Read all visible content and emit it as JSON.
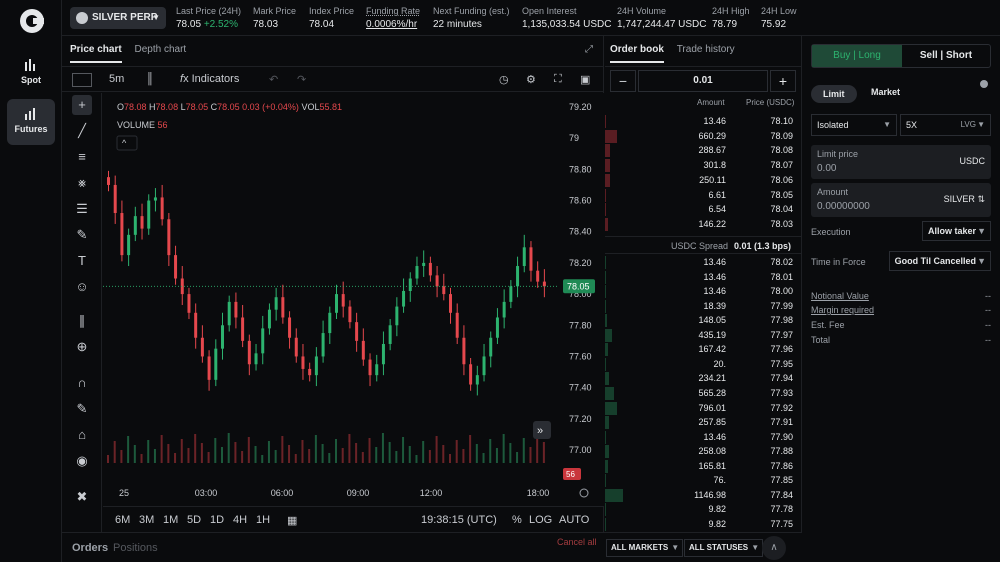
{
  "nav": {
    "items": [
      {
        "label": "Spot",
        "active": false
      },
      {
        "label": "Futures",
        "active": true
      }
    ]
  },
  "header": {
    "market": "SILVER PERP",
    "stats": [
      {
        "label": "Last Price (24H)",
        "value": "78.05",
        "change": "+2.52%"
      },
      {
        "label": "Mark Price",
        "value": "78.03"
      },
      {
        "label": "Index Price",
        "value": "78.04"
      },
      {
        "label": "Funding Rate",
        "value": "0.0006%/hr"
      },
      {
        "label": "Next Funding (est.)",
        "value": "22 minutes"
      },
      {
        "label": "Open Interest",
        "value": "1,135,033.54 USDC"
      },
      {
        "label": "24H Volume",
        "value": "1,747,244.47 USDC"
      },
      {
        "label": "24H High",
        "value": "78.79"
      },
      {
        "label": "24H Low",
        "value": "75.92"
      }
    ]
  },
  "chart_panel": {
    "tabs": [
      "Price chart",
      "Depth chart"
    ],
    "toolbar": {
      "interval": "5m",
      "indicators": "Indicators"
    },
    "ohlc": {
      "o_label": "O",
      "o": "78.08",
      "h_label": "H",
      "h": "78.08",
      "l_label": "L",
      "l": "78.05",
      "c_label": "C",
      "c": "78.05",
      "chg": "0.03 (+0.04%)",
      "vol_label": "VOL",
      "vol": "55.81"
    },
    "volume_label": "VOLUME",
    "volume_value": "56",
    "timeframes": [
      "6M",
      "3M",
      "1M",
      "5D",
      "1D",
      "4H",
      "1H"
    ],
    "clock": "19:38:15 (UTC)",
    "scale_options": [
      "%",
      "LOG",
      "AUTO"
    ]
  },
  "chart_data": {
    "type": "candlestick",
    "title": "",
    "y_ticks": [
      "79.20",
      "79",
      "78.80",
      "78.60",
      "78.40",
      "78.20",
      "78.00",
      "77.80",
      "77.60",
      "77.40",
      "77.20",
      "77.00"
    ],
    "x_ticks": [
      "25",
      "03:00",
      "06:00",
      "09:00",
      "12:00",
      "18:00"
    ],
    "ylim": [
      77.0,
      79.2
    ],
    "last_price": "78.05",
    "last_volume": "56",
    "closes": [
      78.7,
      78.52,
      78.25,
      78.38,
      78.5,
      78.42,
      78.6,
      78.62,
      78.48,
      78.25,
      78.1,
      78.0,
      77.88,
      77.72,
      77.6,
      77.45,
      77.65,
      77.8,
      77.95,
      77.85,
      77.7,
      77.55,
      77.62,
      77.78,
      77.9,
      77.98,
      77.85,
      77.72,
      77.6,
      77.52,
      77.48,
      77.6,
      77.75,
      77.88,
      78.0,
      77.92,
      77.82,
      77.7,
      77.58,
      77.48,
      77.55,
      77.68,
      77.8,
      77.92,
      78.02,
      78.1,
      78.18,
      78.2,
      78.12,
      78.05,
      78.0,
      77.88,
      77.72,
      77.55,
      77.42,
      77.48,
      77.6,
      77.72,
      77.85,
      77.95,
      78.05,
      78.18,
      78.3,
      78.15,
      78.08,
      78.05
    ]
  },
  "order_book": {
    "tabs": [
      "Order book",
      "Trade history"
    ],
    "tick": "0.01",
    "headers": {
      "amount": "Amount",
      "price": "Price (USDC)"
    },
    "asks": [
      {
        "amount": "13.46",
        "price": "78.10"
      },
      {
        "amount": "660.29",
        "price": "78.09"
      },
      {
        "amount": "288.67",
        "price": "78.08"
      },
      {
        "amount": "301.8",
        "price": "78.07"
      },
      {
        "amount": "250.11",
        "price": "78.06"
      },
      {
        "amount": "6.61",
        "price": "78.05"
      },
      {
        "amount": "6.54",
        "price": "78.04"
      },
      {
        "amount": "146.22",
        "price": "78.03"
      }
    ],
    "spread_label": "USDC Spread",
    "spread_value": "0.01 (1.3 bps)",
    "bids": [
      {
        "amount": "13.46",
        "price": "78.02"
      },
      {
        "amount": "13.46",
        "price": "78.01"
      },
      {
        "amount": "13.46",
        "price": "78.00"
      },
      {
        "amount": "18.39",
        "price": "77.99"
      },
      {
        "amount": "148.05",
        "price": "77.98"
      },
      {
        "amount": "435.19",
        "price": "77.97"
      },
      {
        "amount": "167.42",
        "price": "77.96"
      },
      {
        "amount": "20.",
        "price": "77.95"
      },
      {
        "amount": "234.21",
        "price": "77.94"
      },
      {
        "amount": "565.28",
        "price": "77.93"
      },
      {
        "amount": "796.01",
        "price": "77.92"
      },
      {
        "amount": "257.85",
        "price": "77.91"
      },
      {
        "amount": "13.46",
        "price": "77.90"
      },
      {
        "amount": "258.08",
        "price": "77.88"
      },
      {
        "amount": "165.81",
        "price": "77.86"
      },
      {
        "amount": "76.",
        "price": "77.85"
      },
      {
        "amount": "1146.98",
        "price": "77.84"
      },
      {
        "amount": "9.82",
        "price": "77.78"
      },
      {
        "amount": "9.82",
        "price": "77.75"
      }
    ]
  },
  "order_form": {
    "buy_label": "Buy | Long",
    "sell_label": "Sell | Short",
    "types": [
      "Limit",
      "Market"
    ],
    "margin_mode": "Isolated",
    "leverage": "5X",
    "leverage_unit": "LVG",
    "limit_price": {
      "label": "Limit price",
      "value": "0.00",
      "unit": "USDC"
    },
    "amount": {
      "label": "Amount",
      "value": "0.00000000",
      "unit": "SILVER"
    },
    "execution": {
      "label": "Execution",
      "value": "Allow taker"
    },
    "tif": {
      "label": "Time in Force",
      "value": "Good Til Cancelled"
    },
    "summary": [
      {
        "label": "Notional Value",
        "value": "--",
        "underline": true
      },
      {
        "label": "Margin required",
        "value": "--",
        "underline": true
      },
      {
        "label": "Est. Fee",
        "value": "--",
        "underline": false
      },
      {
        "label": "Total",
        "value": "--",
        "underline": false
      }
    ]
  },
  "bottom": {
    "tabs": [
      "Orders",
      "Positions"
    ],
    "cancel_all": "Cancel all",
    "filters": [
      "ALL MARKETS",
      "ALL STATUSES"
    ]
  }
}
